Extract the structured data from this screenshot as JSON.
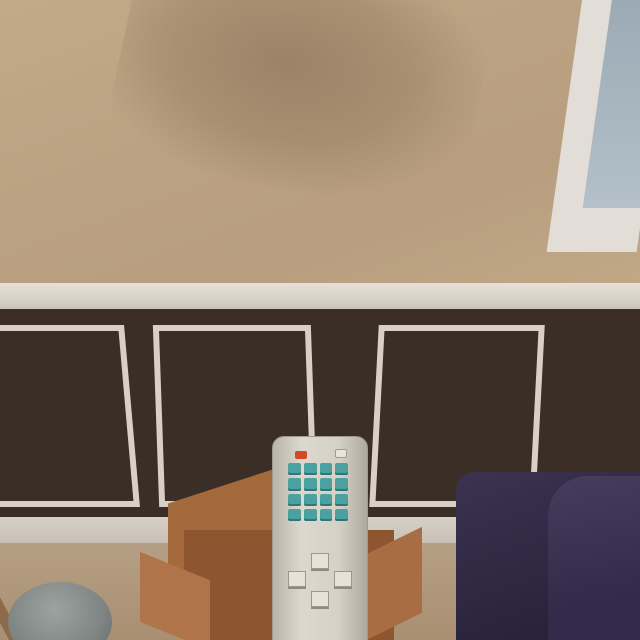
{
  "scene": {
    "description_type": "first-person 3D room view",
    "colors": {
      "wall_upper": "#bba282",
      "wainscot": "#3a2e27",
      "trim": "#d8d0c6",
      "carpet": "#ad9477",
      "box": "#8d5530",
      "bed": "#2c2640",
      "remote_body": "#d6d1c5",
      "remote_keys": "#4aa1a0",
      "remote_power": "#d24a26"
    },
    "remote": {
      "keypad_rows": 4,
      "keypad_columns": 4
    }
  }
}
